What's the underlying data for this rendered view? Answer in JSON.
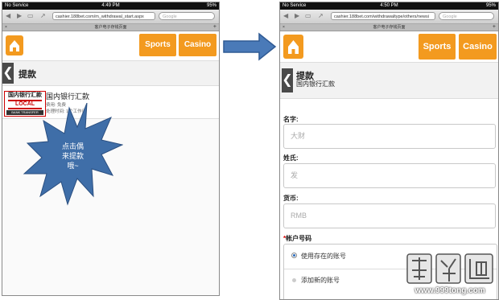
{
  "left_screen": {
    "status": {
      "carrier": "No Service",
      "time": "4:49 PM",
      "battery": "95%"
    },
    "url": "cashier.188bet.com/m_withdrawal_start.aspx",
    "search_placeholder": "Google",
    "tab_title": "客户电子存钱页面",
    "header": {
      "sports": "Sports",
      "casino": "Casino"
    },
    "page_title": "提款",
    "method": {
      "logo_line1": "国内银行汇款",
      "logo_line2": "LOCAL",
      "logo_line3": "BANK TRANSFER",
      "name": "国内银行汇款",
      "fee": "费用: 免费",
      "time": "处理时间: 1个工作日"
    },
    "callout": {
      "line1": "点击偶",
      "line2": "来提款",
      "line3": "哦~"
    }
  },
  "right_screen": {
    "status": {
      "carrier": "No Service",
      "time": "4:50 PM",
      "battery": "95%"
    },
    "url": "cashier.188bet.com/withdrawaltype/others/newsi",
    "search_placeholder": "Google",
    "tab_title": "客户电子存钱页面",
    "header": {
      "sports": "Sports",
      "casino": "Casino"
    },
    "page_title": "提款",
    "page_subtitle": "国内银行汇款",
    "form": {
      "first_name_label": "名字:",
      "first_name_placeholder": "大财",
      "last_name_label": "姓氏:",
      "last_name_placeholder": "发",
      "currency_label": "货币:",
      "currency_value": "RMB",
      "account_label_star": "*",
      "account_label": "帐户号码",
      "option_existing": "使用存在的账号",
      "option_new": "添加新的账号"
    }
  },
  "watermark": {
    "text": "www.999tong.com"
  },
  "colors": {
    "accent": "#f39a1f",
    "callout_blue": "#3f6ea8",
    "arrow_blue": "#4a7ab8"
  }
}
